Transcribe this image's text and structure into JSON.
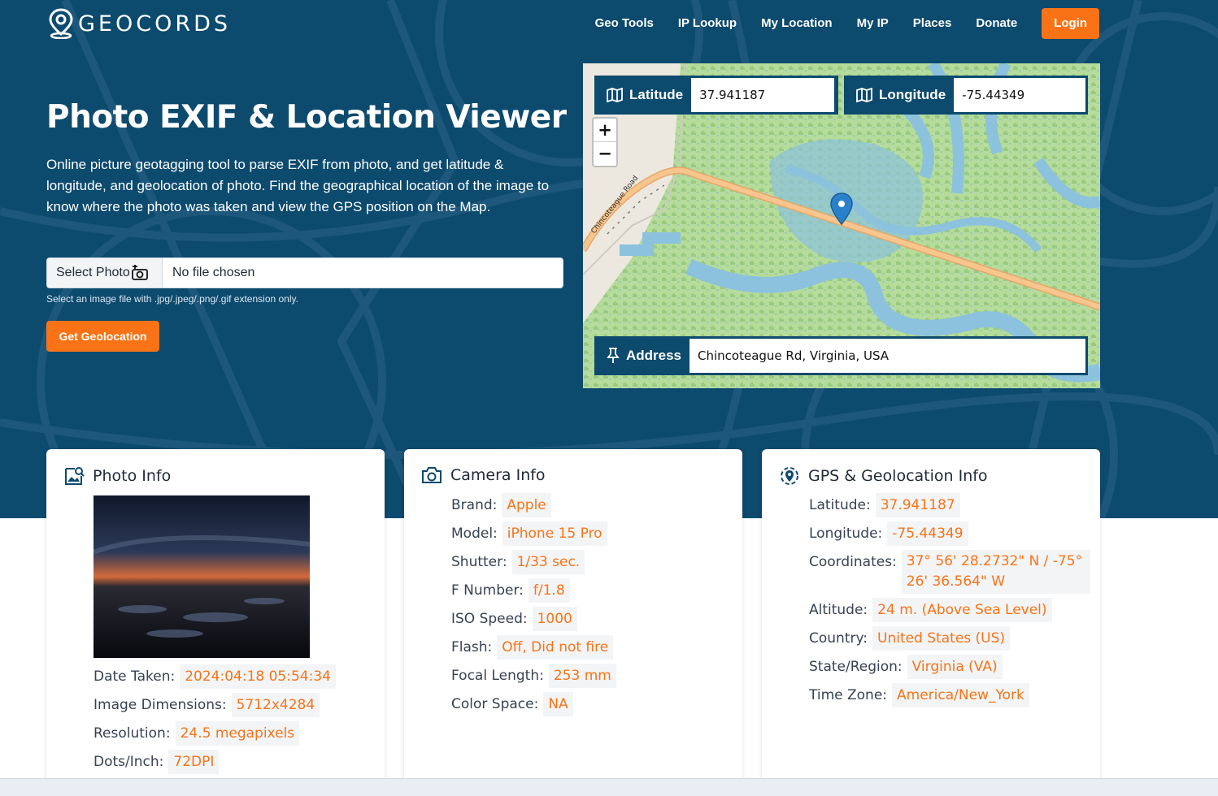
{
  "nav": {
    "brand": "GEOCORDS",
    "links": [
      "Geo Tools",
      "IP Lookup",
      "My Location",
      "My IP",
      "Places",
      "Donate"
    ],
    "login": "Login"
  },
  "hero": {
    "title": "Photo EXIF & Location Viewer",
    "description": "Online picture geotagging tool to parse EXIF from photo, and get latitude & longitude, and geolocation of photo. Find the geographical location of the image to know where the photo was taken and view the GPS position on the Map.",
    "select_photo": "Select Photo",
    "file_name": "No file chosen",
    "hint": "Select an image file with .jpg/.jpeg/.png/.gif extension only.",
    "geo_button": "Get Geolocation"
  },
  "map": {
    "latitude_label": "Latitude",
    "latitude_value": "37.941187",
    "longitude_label": "Longitude",
    "longitude_value": "-75.44349",
    "address_label": "Address",
    "address_value": "Chincoteague Rd, Virginia, USA",
    "road_label": "Chincoteague Road",
    "zoom_in": "+",
    "zoom_out": "−"
  },
  "photo_info": {
    "title": "Photo Info",
    "rows": [
      {
        "k": "Date Taken:",
        "v": "2024:04:18 05:54:34"
      },
      {
        "k": "Image Dimensions:",
        "v": "5712x4284"
      },
      {
        "k": "Resolution:",
        "v": "24.5 megapixels"
      },
      {
        "k": "Dots/Inch:",
        "v": "72DPI"
      }
    ]
  },
  "camera_info": {
    "title": "Camera Info",
    "rows": [
      {
        "k": "Brand:",
        "v": "Apple"
      },
      {
        "k": "Model:",
        "v": "iPhone 15 Pro"
      },
      {
        "k": "Shutter:",
        "v": "1/33 sec."
      },
      {
        "k": "F Number:",
        "v": "f/1.8"
      },
      {
        "k": "ISO Speed:",
        "v": "1000"
      },
      {
        "k": "Flash:",
        "v": "Off, Did not fire"
      },
      {
        "k": "Focal Length:",
        "v": "253 mm"
      },
      {
        "k": "Color Space:",
        "v": "NA"
      }
    ]
  },
  "gps_info": {
    "title": "GPS & Geolocation Info",
    "rows": [
      {
        "k": "Latitude:",
        "v": "37.941187"
      },
      {
        "k": "Longitude:",
        "v": "-75.44349"
      },
      {
        "k": "Coordinates:",
        "v": "37° 56' 28.2732\" N / -75° 26' 36.564\" W"
      },
      {
        "k": "Altitude:",
        "v": "24 m. (Above Sea Level)"
      },
      {
        "k": "Country:",
        "v": "United States (US)"
      },
      {
        "k": "State/Region:",
        "v": "Virginia (VA)"
      },
      {
        "k": "Time Zone:",
        "v": "America/New_York"
      }
    ]
  },
  "colors": {
    "primary": "#0c4a6e",
    "accent": "#f97316"
  }
}
